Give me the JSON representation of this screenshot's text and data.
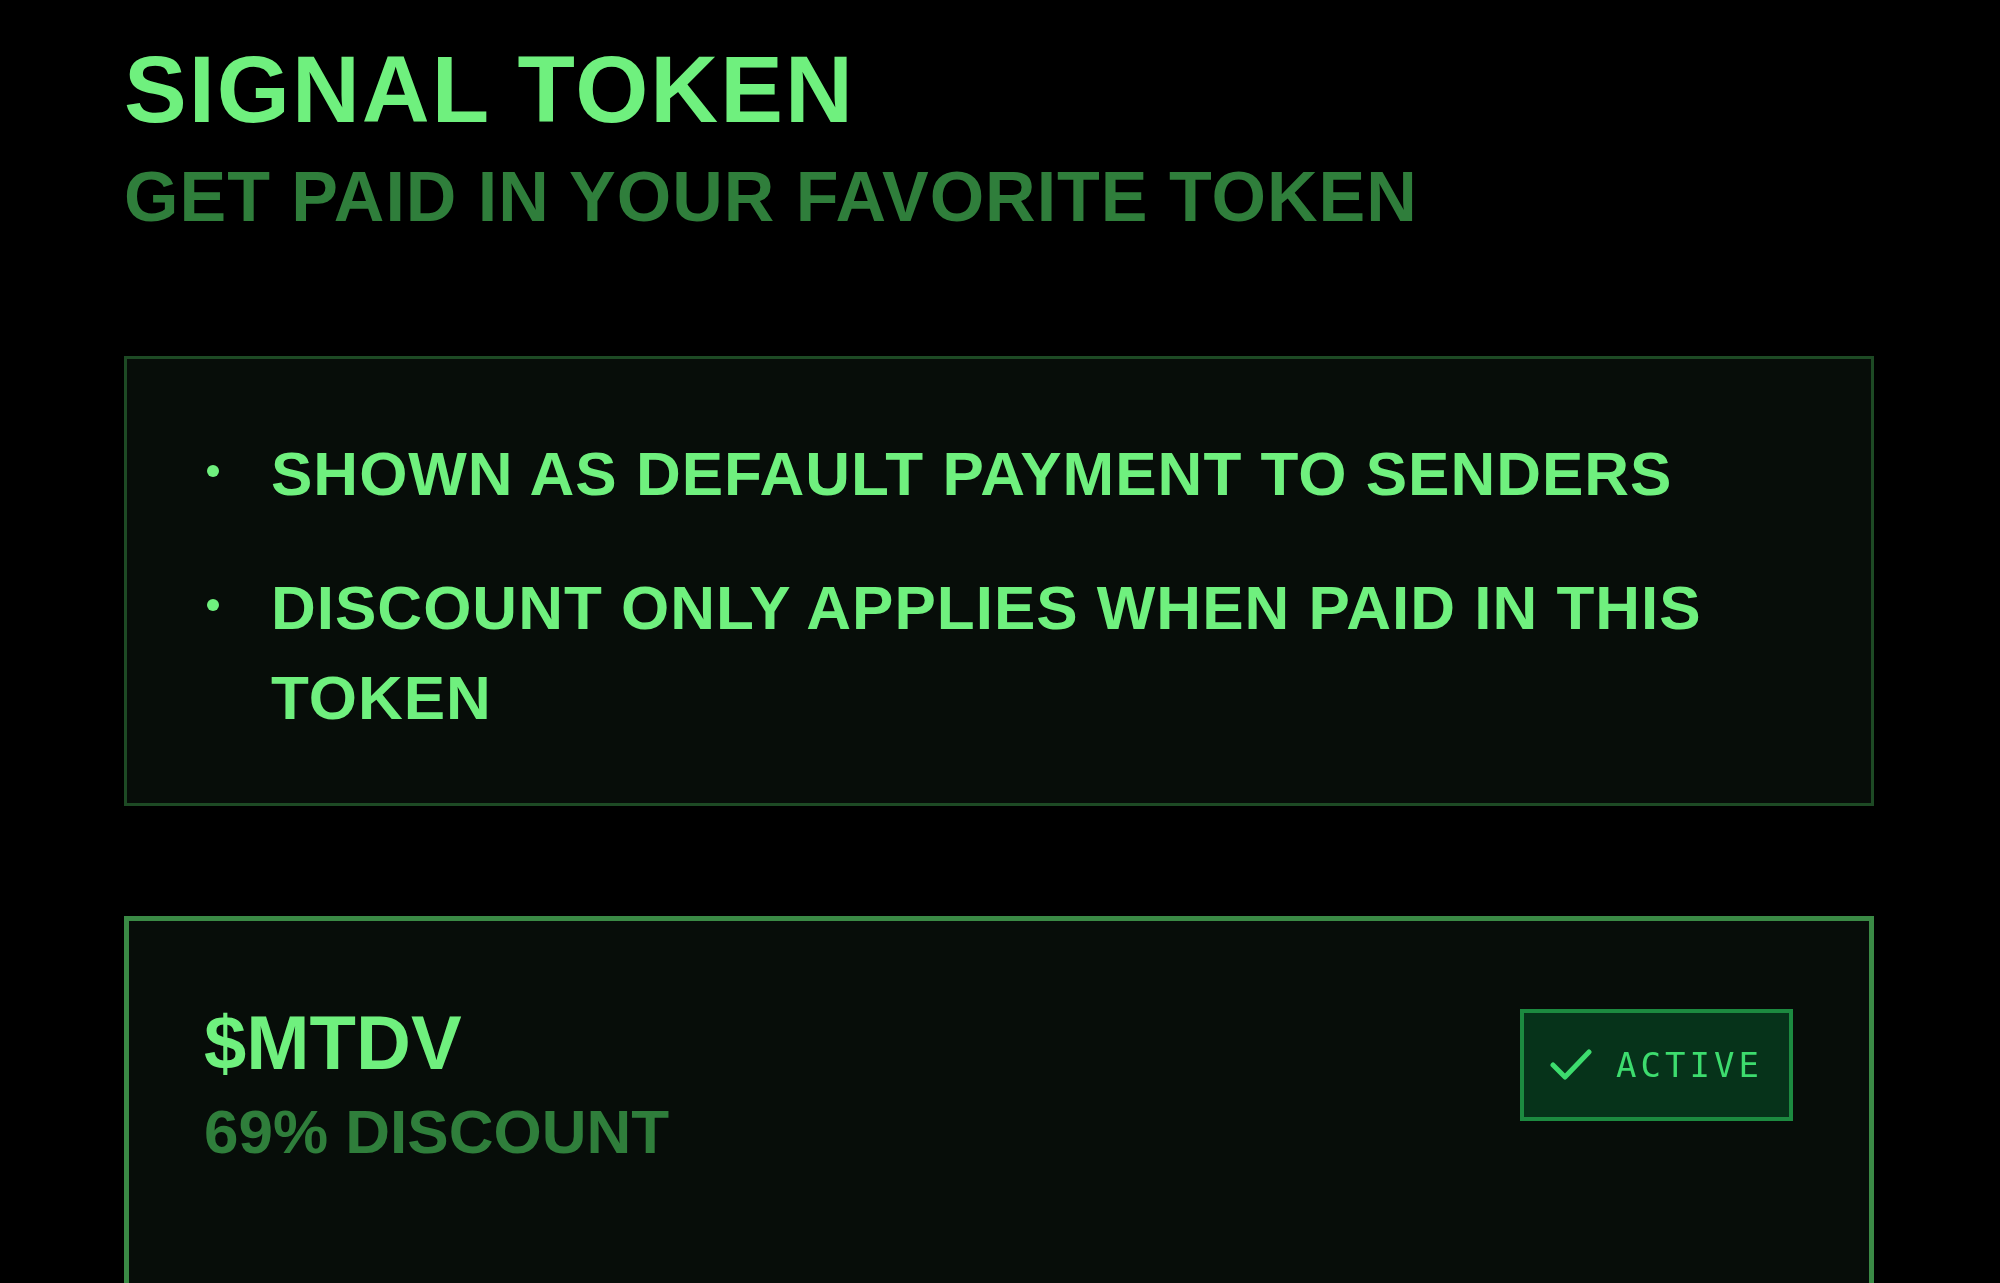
{
  "title": "SIGNAL TOKEN",
  "subtitle": "GET PAID IN YOUR FAVORITE TOKEN",
  "notes": [
    "SHOWN AS DEFAULT PAYMENT TO SENDERS",
    "DISCOUNT ONLY APPLIES WHEN PAID IN THIS TOKEN"
  ],
  "token": {
    "symbol": "$MTDV",
    "discount": "69% DISCOUNT",
    "active": true,
    "badge": "ACTIVE"
  }
}
